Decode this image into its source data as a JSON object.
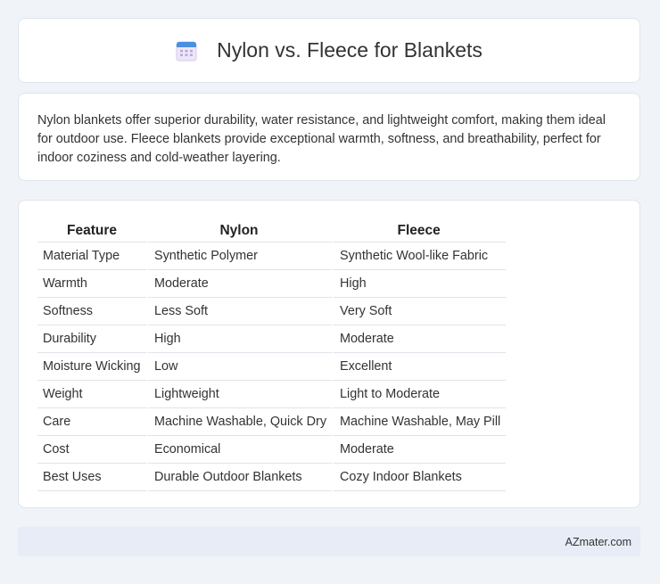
{
  "header": {
    "icon": "calendar-icon",
    "title": "Nylon vs. Fleece for Blankets"
  },
  "intro": {
    "text": "Nylon blankets offer superior durability, water resistance, and lightweight comfort, making them ideal for outdoor use. Fleece blankets provide exceptional warmth, softness, and breathability, perfect for indoor coziness and cold-weather layering."
  },
  "table": {
    "headers": [
      "Feature",
      "Nylon",
      "Fleece"
    ],
    "rows": [
      [
        "Material Type",
        "Synthetic Polymer",
        "Synthetic Wool-like Fabric"
      ],
      [
        "Warmth",
        "Moderate",
        "High"
      ],
      [
        "Softness",
        "Less Soft",
        "Very Soft"
      ],
      [
        "Durability",
        "High",
        "Moderate"
      ],
      [
        "Moisture Wicking",
        "Low",
        "Excellent"
      ],
      [
        "Weight",
        "Lightweight",
        "Light to Moderate"
      ],
      [
        "Care",
        "Machine Washable, Quick Dry",
        "Machine Washable, May Pill"
      ],
      [
        "Cost",
        "Economical",
        "Moderate"
      ],
      [
        "Best Uses",
        "Durable Outdoor Blankets",
        "Cozy Indoor Blankets"
      ]
    ]
  },
  "footer": {
    "link": "AZmater.com"
  },
  "colors": {
    "background": "#f0f3f8",
    "card": "#ffffff",
    "footer": "#e7ecf7",
    "icon_top": "#4a8fe0",
    "icon_grid": "#b7a3dd"
  }
}
